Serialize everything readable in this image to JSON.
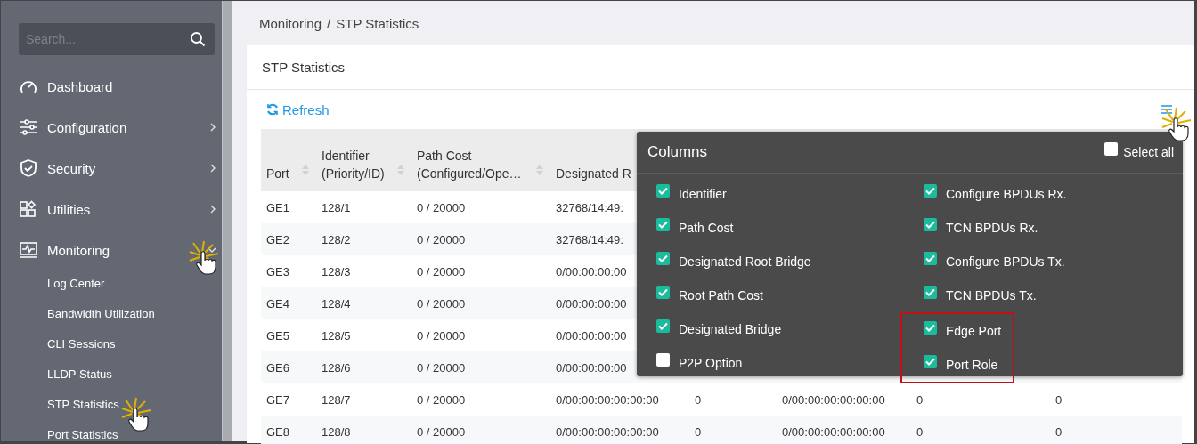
{
  "sidebar": {
    "search": {
      "placeholder": "Search..."
    },
    "items": [
      {
        "label": "Dashboard"
      },
      {
        "label": "Configuration",
        "expanded": false
      },
      {
        "label": "Security",
        "expanded": false
      },
      {
        "label": "Utilities",
        "expanded": false
      },
      {
        "label": "Monitoring",
        "expanded": true,
        "children": [
          {
            "label": "Log Center"
          },
          {
            "label": "Bandwidth Utilization"
          },
          {
            "label": "CLI Sessions"
          },
          {
            "label": "LLDP Status"
          },
          {
            "label": "STP Statistics"
          },
          {
            "label": "Port Statistics"
          }
        ]
      }
    ]
  },
  "breadcrumb": {
    "items": [
      "Monitoring",
      "STP Statistics"
    ],
    "separator": "/"
  },
  "card": {
    "title": "STP Statistics",
    "refresh": "Refresh",
    "table": {
      "columns": [
        {
          "label": "Port"
        },
        {
          "label": "Identifier\n(Priority/ID)"
        },
        {
          "label": "Path Cost\n(Configured/Ope…"
        },
        {
          "label": "Designated R"
        }
      ],
      "rows": [
        {
          "cells": [
            "GE1",
            "128/1",
            "0 / 20000",
            "32768/14:49:"
          ]
        },
        {
          "cells": [
            "GE2",
            "128/2",
            "0 / 20000",
            "32768/14:49:"
          ]
        },
        {
          "cells": [
            "GE3",
            "128/3",
            "0 / 20000",
            "0/00:00:00:00"
          ]
        },
        {
          "cells": [
            "GE4",
            "128/4",
            "0 / 20000",
            "0/00:00:00:00"
          ]
        },
        {
          "cells": [
            "GE5",
            "128/5",
            "0 / 20000",
            "0/00:00:00:00"
          ]
        },
        {
          "cells": [
            "GE6",
            "128/6",
            "0 / 20000",
            "0/00:00:00:00"
          ]
        },
        {
          "cells": [
            "GE7",
            "128/7",
            "0 / 20000",
            "0/00:00:00:00:00:00",
            "0",
            "0/00:00:00:00:00:00",
            "0",
            "0"
          ]
        },
        {
          "cells": [
            "GE8",
            "128/8",
            "0 / 20000",
            "0/00:00:00:00:00:00",
            "0",
            "0/00:00:00:00:00:00",
            "0",
            "0"
          ]
        }
      ]
    }
  },
  "columns_popup": {
    "title": "Columns",
    "select_all": {
      "label": "Select all",
      "checked": false
    },
    "options": [
      {
        "label": "Identifier",
        "checked": true,
        "highlighted": false
      },
      {
        "label": "Path Cost",
        "checked": true,
        "highlighted": false
      },
      {
        "label": "Designated Root Bridge",
        "checked": true,
        "highlighted": false
      },
      {
        "label": "Root Path Cost",
        "checked": true,
        "highlighted": false
      },
      {
        "label": "Designated Bridge",
        "checked": true,
        "highlighted": false
      },
      {
        "label": "P2P Option",
        "checked": false,
        "highlighted": false
      },
      {
        "label": "Configure BPDUs Rx.",
        "checked": true,
        "highlighted": false
      },
      {
        "label": "TCN BPDUs Rx.",
        "checked": true,
        "highlighted": false
      },
      {
        "label": "Configure BPDUs Tx.",
        "checked": true,
        "highlighted": false
      },
      {
        "label": "TCN BPDUs Tx.",
        "checked": true,
        "highlighted": false
      },
      {
        "label": "Edge Port",
        "checked": true,
        "highlighted": true
      },
      {
        "label": "Port Role",
        "checked": true,
        "highlighted": true
      }
    ]
  }
}
